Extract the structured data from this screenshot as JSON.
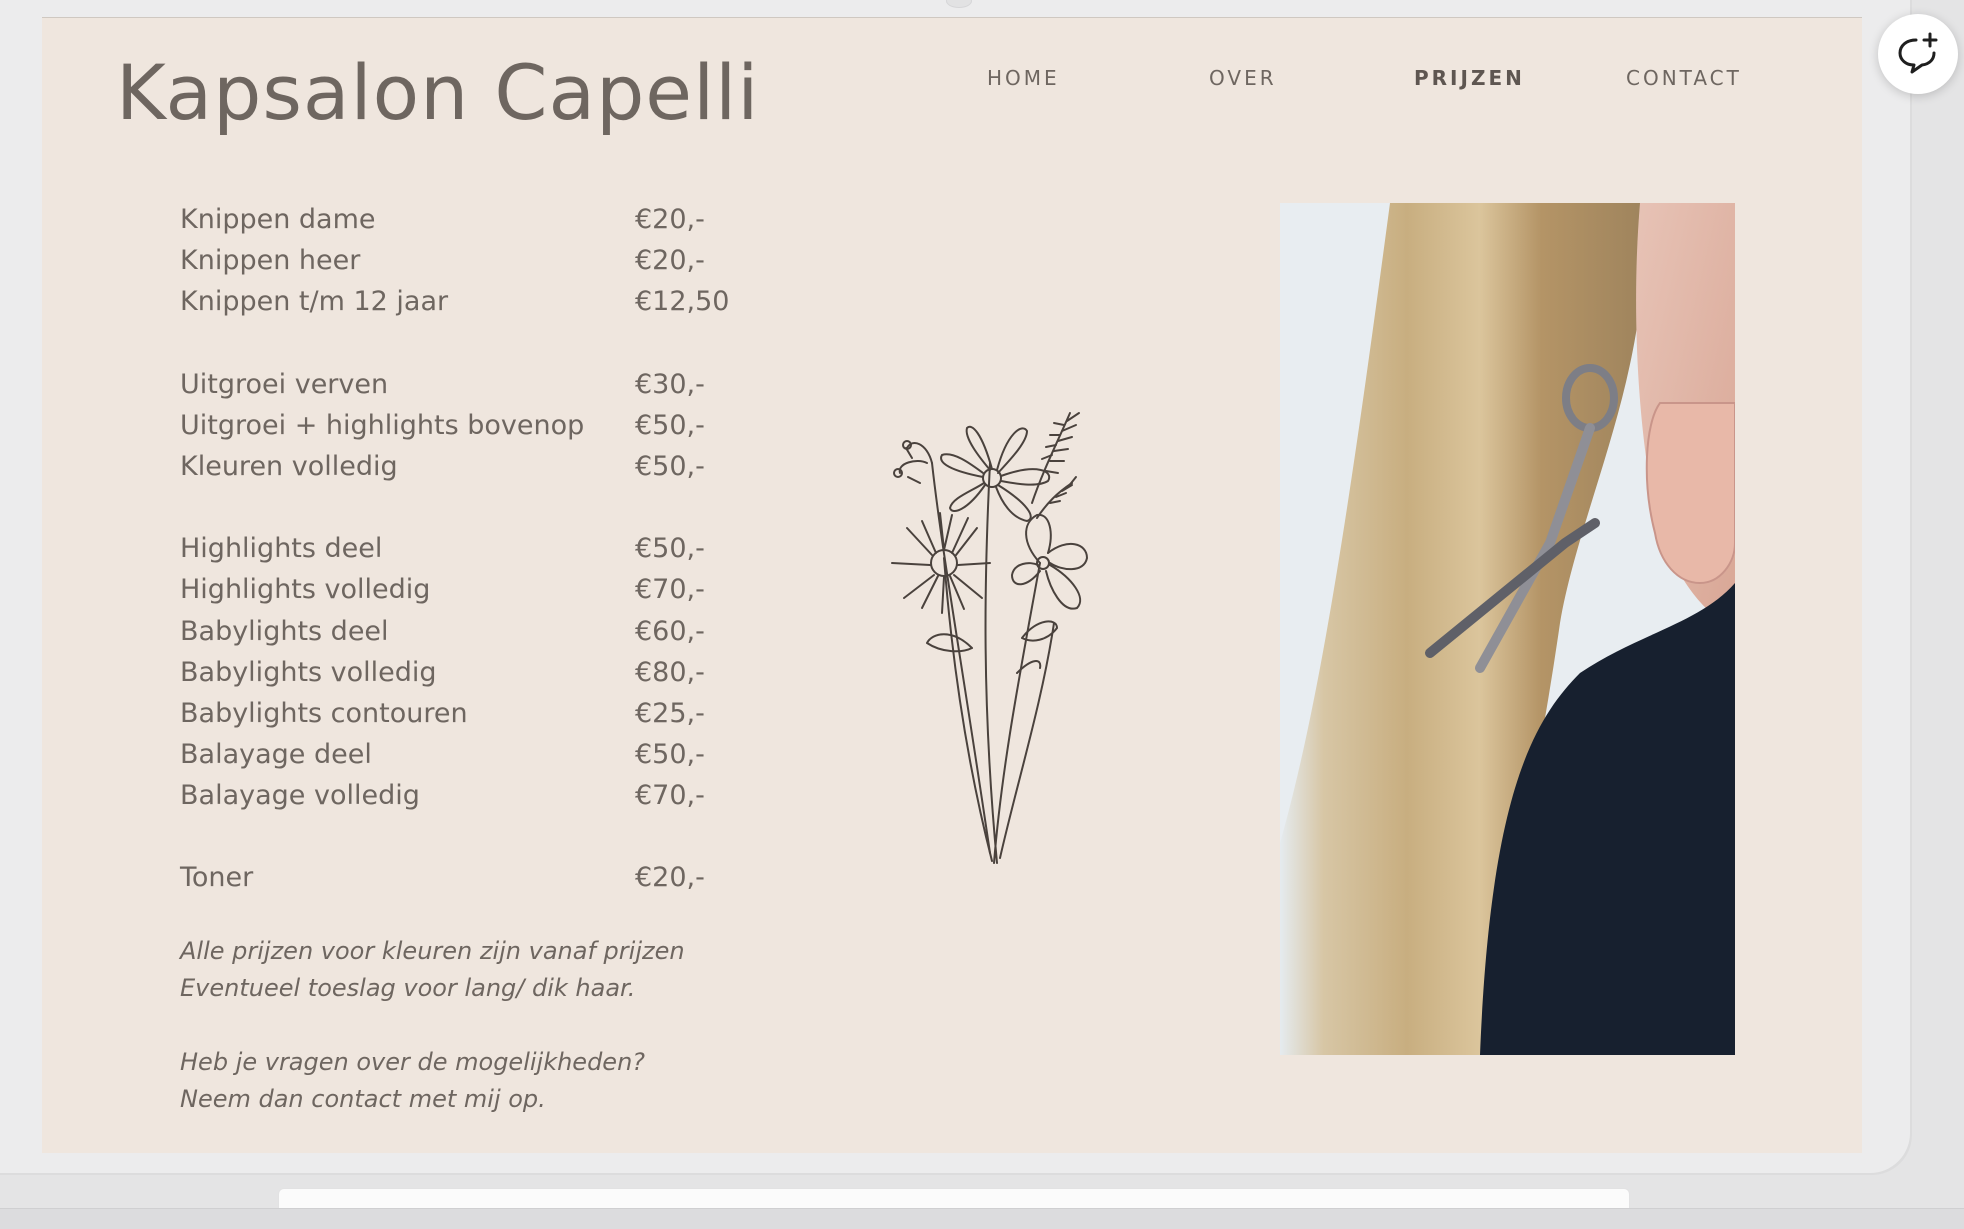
{
  "site": {
    "title": "Kapsalon Capelli"
  },
  "nav": {
    "items": [
      {
        "label": "HOME"
      },
      {
        "label": "OVER"
      },
      {
        "label": "PRIJZEN",
        "active": true
      },
      {
        "label": "CONTACT"
      }
    ]
  },
  "prices": {
    "groups": [
      [
        {
          "label": "Knippen dame",
          "price": "€20,-"
        },
        {
          "label": "Knippen heer",
          "price": "€20,-"
        },
        {
          "label": "Knippen t/m 12 jaar",
          "price": "€12,50"
        }
      ],
      [
        {
          "label": "Uitgroei verven",
          "price": "€30,-"
        },
        {
          "label": "Uitgroei + highlights bovenop",
          "price": "€50,-"
        },
        {
          "label": "Kleuren volledig",
          "price": "€50,-"
        }
      ],
      [
        {
          "label": "Highlights deel",
          "price": "€50,-"
        },
        {
          "label": "Highlights volledig",
          "price": "€70,-"
        },
        {
          "label": "Babylights deel",
          "price": "€60,-"
        },
        {
          "label": "Babylights volledig",
          "price": "€80,-"
        },
        {
          "label": "Babylights contouren",
          "price": "€25,-"
        },
        {
          "label": "Balayage deel",
          "price": "€50,-"
        },
        {
          "label": "Balayage volledig",
          "price": "€70,-"
        }
      ],
      [
        {
          "label": "Toner",
          "price": "€20,-"
        }
      ]
    ]
  },
  "notes": {
    "line1": "Alle prijzen voor kleuren zijn vanaf prijzen",
    "line2": "Eventueel toeslag voor lang/ dik haar.",
    "line3": "Heb je vragen over de mogelijkheden?",
    "line4": "Neem dan contact met mij op."
  },
  "colors": {
    "page_background": "#efe6de",
    "text": "#6e6660",
    "illustration_stroke": "#4a423d"
  },
  "icons": {
    "chat": "chat-bubble-plus-icon",
    "flower": "flower-bouquet-illustration"
  }
}
